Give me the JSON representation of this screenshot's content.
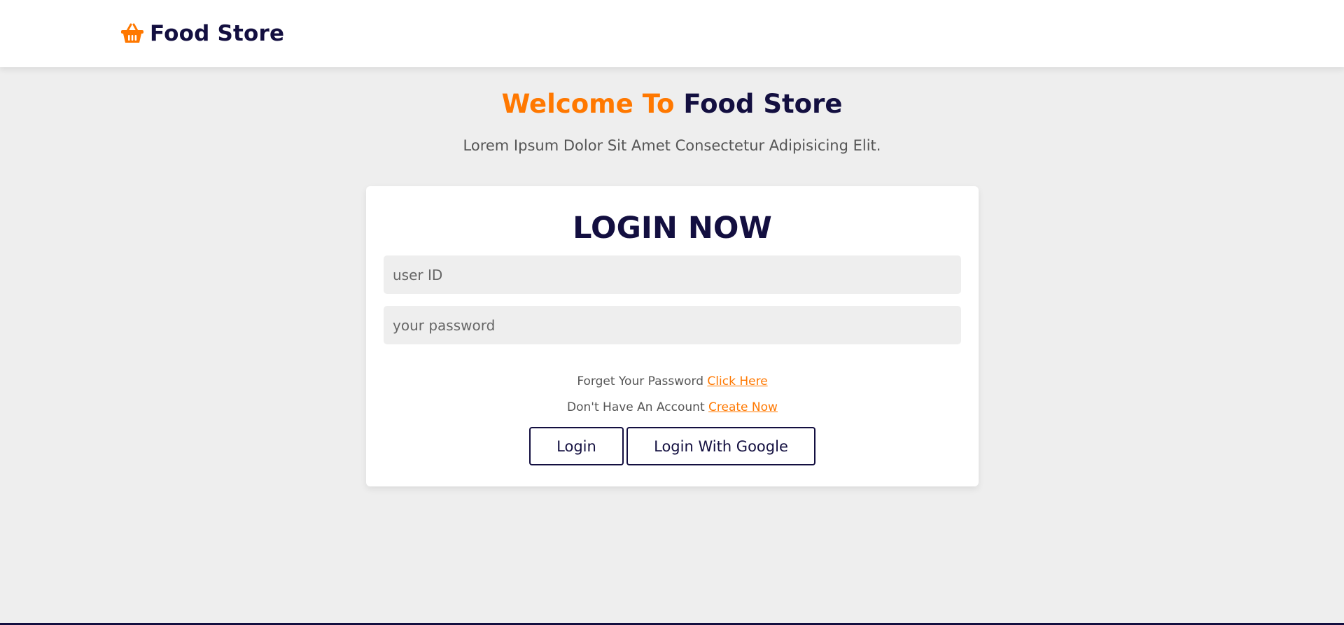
{
  "colors": {
    "accent": "#ff7800",
    "brand": "#130f40",
    "background": "#eeeeee"
  },
  "header": {
    "logo_icon": "shopping-basket-icon",
    "logo_text": "Food Store"
  },
  "hero": {
    "title_accent": "Welcome To",
    "title_main": "Food Store",
    "subtitle": "Lorem Ipsum Dolor Sit Amet Consectetur Adipisicing Elit."
  },
  "login": {
    "title": "LOGIN NOW",
    "user_placeholder": "user ID",
    "password_placeholder": "your password",
    "forgot_text": "Forget Your Password",
    "forgot_link": "Click Here",
    "account_text": "Don't Have An Account",
    "account_link": "Create Now",
    "login_button": "Login",
    "google_button": "Login With Google"
  }
}
